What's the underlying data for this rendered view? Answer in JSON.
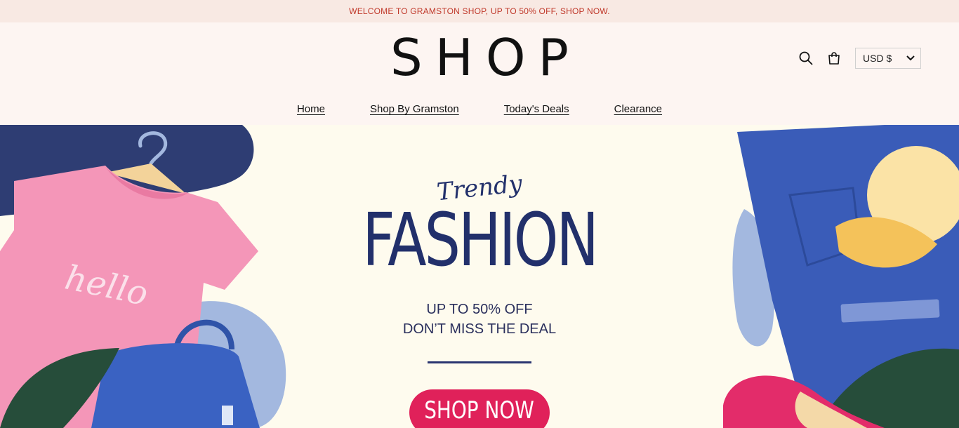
{
  "announcement": "WELCOME TO GRAMSTON SHOP, UP TO 50% OFF, SHOP NOW.",
  "logo": "SHOP",
  "header": {
    "currency": "USD $",
    "search_icon": "search-icon",
    "cart_icon": "cart-icon"
  },
  "nav": [
    {
      "label": "Home"
    },
    {
      "label": "Shop By Gramston"
    },
    {
      "label": "Today's Deals"
    },
    {
      "label": "Clearance"
    }
  ],
  "hero": {
    "script": "Trendy",
    "headline": "FASHION",
    "line1": "UP TO 50% OFF",
    "line2": "DON’T MISS THE DEAL",
    "cta": "SHOP NOW",
    "shirt_text": "hello",
    "colors": {
      "navy": "#22306b",
      "pink": "#f48fb1",
      "cta": "#e0215a",
      "blue": "#3f5fb8",
      "cream": "#fefbee"
    }
  }
}
